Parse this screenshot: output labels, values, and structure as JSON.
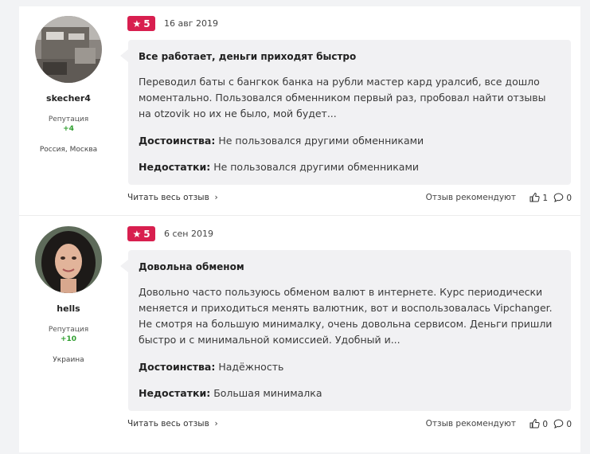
{
  "reviews": [
    {
      "user": {
        "name": "skecher4",
        "reputation_label": "Репутация",
        "reputation_value": "+4",
        "location": "Россия, Москва"
      },
      "rating": "5",
      "date": "16 авг 2019",
      "title": "Все работает, деньги приходят быстро",
      "text": "Переводил баты с бангкок банка на рубли мастер кард уралсиб, все дошло моментально. Пользовался обменником первый раз, пробовал найти отзывы на otzovik но их не было, мой будет...",
      "pros_label": "Достоинства:",
      "pros": "Не пользовался другими обменниками",
      "cons_label": "Недостатки:",
      "cons": "Не пользовался другими обменниками",
      "read_more": "Читать весь отзыв",
      "recommend_label": "Отзыв рекомендуют",
      "likes": "1",
      "comments": "0"
    },
    {
      "user": {
        "name": "hells",
        "reputation_label": "Репутация",
        "reputation_value": "+10",
        "location": "Украина"
      },
      "rating": "5",
      "date": "6 сен 2019",
      "title": "Довольна обменом",
      "text": "Довольно часто пользуюсь обменом валют в интернете. Курс периодически меняется и приходиться менять валютник, вот и воспользовалась Vipchanger. Не смотря на большую минималку, очень довольна сервисом. Деньги пришли быстро и с минимальной комиссией. Удобный и...",
      "pros_label": "Достоинства:",
      "pros": "Надёжность",
      "cons_label": "Недостатки:",
      "cons": "Большая минималка",
      "read_more": "Читать весь отзыв",
      "recommend_label": "Отзыв рекомендуют",
      "likes": "0",
      "comments": "0"
    }
  ],
  "icons": {
    "star": "star-icon",
    "chevron": "chevron-right-icon",
    "like": "thumbs-up-icon",
    "comment": "comment-icon"
  },
  "colors": {
    "badge": "#d81f4f",
    "reputation": "#2e9e2e",
    "review_bg": "#f1f1f3"
  }
}
